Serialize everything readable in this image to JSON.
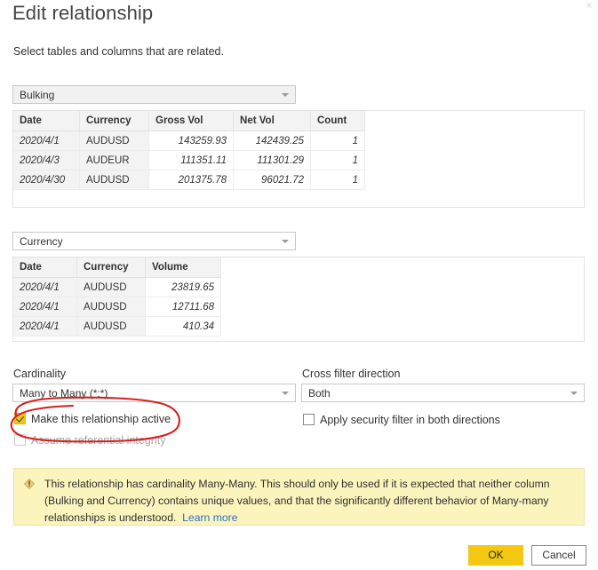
{
  "dialog": {
    "title": "Edit relationship",
    "subtitle": "Select tables and columns that are related.",
    "close_icon": "×"
  },
  "table1": {
    "selected": "Bulking",
    "columns": [
      "Date",
      "Currency",
      "Gross Vol",
      "Net Vol",
      "Count"
    ],
    "rows": [
      [
        "2020/4/1",
        "AUDUSD",
        "143259.93",
        "142439.25",
        "1"
      ],
      [
        "2020/4/3",
        "AUDEUR",
        "111351.11",
        "111301.29",
        "1"
      ],
      [
        "2020/4/30",
        "AUDUSD",
        "201375.78",
        "96021.72",
        "1"
      ]
    ]
  },
  "table2": {
    "selected": "Currency",
    "columns": [
      "Date",
      "Currency",
      "Volume"
    ],
    "rows": [
      [
        "2020/4/1",
        "AUDUSD",
        "23819.65"
      ],
      [
        "2020/4/1",
        "AUDUSD",
        "12711.68"
      ],
      [
        "2020/4/1",
        "AUDUSD",
        "410.34"
      ]
    ]
  },
  "options": {
    "cardinality_label": "Cardinality",
    "cardinality_value": "Many to Many (*:*)",
    "crossfilter_label": "Cross filter direction",
    "crossfilter_value": "Both",
    "make_active_label": "Make this relationship active",
    "make_active_checked": true,
    "assume_ri_label": "Assume referential integrity",
    "assume_ri_checked": false,
    "security_filter_label": "Apply security filter in both directions",
    "security_filter_checked": false
  },
  "warning": {
    "icon": "warning-diamond-icon",
    "text": "This relationship has cardinality Many-Many. This should only be used if it is expected that neither column (Bulking and Currency) contains unique values, and that the significantly different behavior of Many-many relationships is understood.",
    "link_label": "Learn more"
  },
  "footer": {
    "ok_label": "OK",
    "cancel_label": "Cancel"
  },
  "annotation": {
    "shape": "hand-drawn-ellipse",
    "color": "#d62020",
    "target": "Make this relationship active"
  },
  "colors": {
    "accent": "#f2c811",
    "warning_bg": "#fbf4bd",
    "warning_border": "#ebe3a6",
    "link": "#2a72c4",
    "annotation_red": "#d62020",
    "checkbox_checked": "#e9c51d"
  }
}
